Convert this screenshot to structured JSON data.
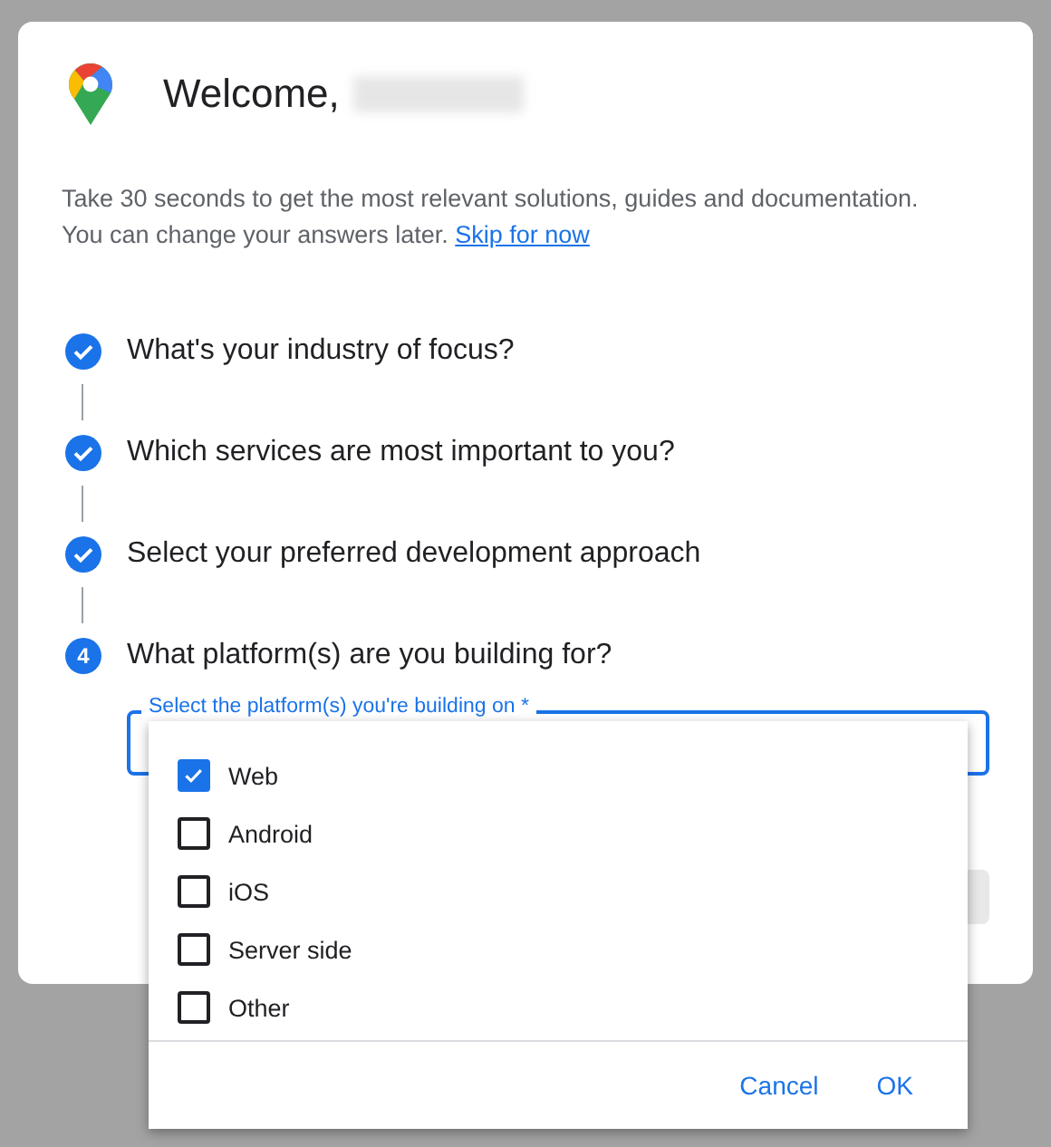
{
  "dialog": {
    "title": "Welcome,",
    "intro": "Take 30 seconds to get the most relevant solutions, guides and documentation. You can change your answers later.",
    "skip_link": "Skip for now"
  },
  "steps": [
    {
      "kind": "done",
      "label": "What's your industry of focus?"
    },
    {
      "kind": "done",
      "label": "Which services are most important to you?"
    },
    {
      "kind": "done",
      "label": "Select your preferred development approach"
    },
    {
      "kind": "current",
      "number": "4",
      "label": "What platform(s) are you building for?"
    }
  ],
  "platform_field": {
    "label": "Select the platform(s) you're building on *"
  },
  "platform_menu": {
    "options": [
      {
        "label": "Web",
        "checked": true
      },
      {
        "label": "Android",
        "checked": false
      },
      {
        "label": "iOS",
        "checked": false
      },
      {
        "label": "Server side",
        "checked": false
      },
      {
        "label": "Other",
        "checked": false
      }
    ],
    "buttons": [
      "Cancel",
      "OK"
    ]
  }
}
